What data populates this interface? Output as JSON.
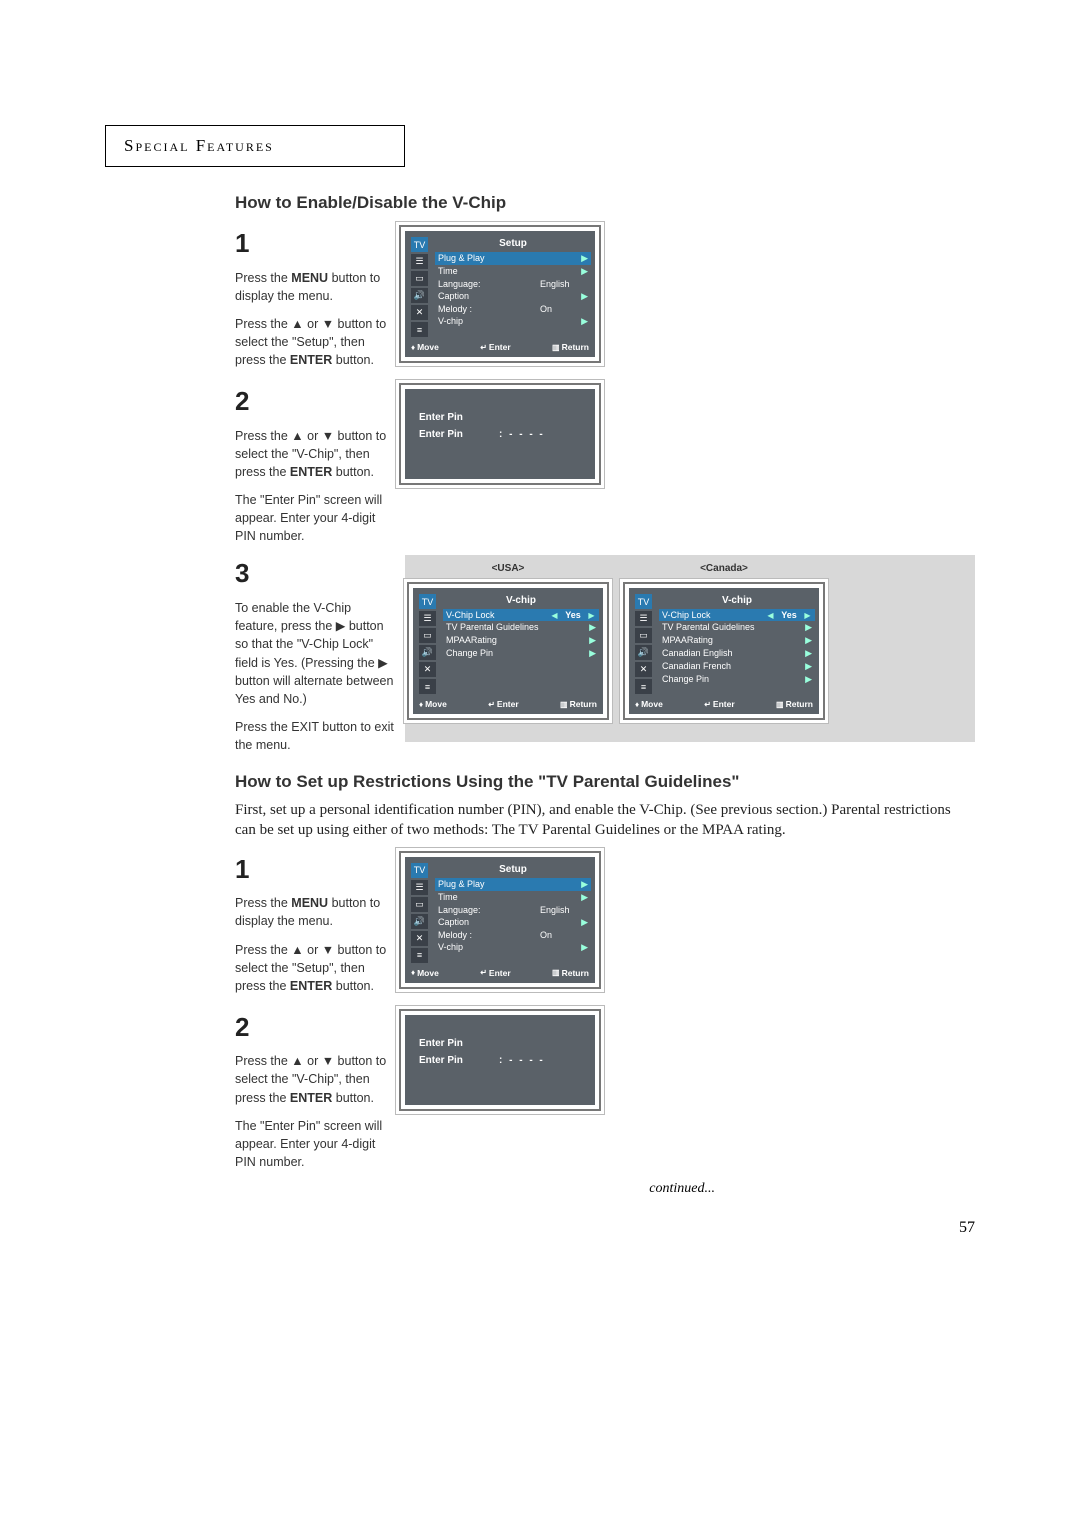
{
  "header": {
    "title": "Special Features"
  },
  "section1": {
    "title": "How to Enable/Disable the V-Chip",
    "step1": {
      "num": "1",
      "para1_a": "Press the ",
      "para1_b": "MENU",
      "para1_c": " button to display the menu.",
      "para2_a": "Press the ▲ or ▼ button to select the \"Setup\", then press the ",
      "para2_b": "ENTER",
      "para2_c": " button."
    },
    "step2": {
      "num": "2",
      "para1_a": "Press the ▲ or ▼ button to select the \"V-Chip\", then press the ",
      "para1_b": "ENTER",
      "para1_c": " button.",
      "para2": "The \"Enter Pin\" screen will appear. Enter your 4-digit PIN number."
    },
    "step3": {
      "num": "3",
      "para1": "To enable the V-Chip feature, press the ▶ button so that the \"V-Chip Lock\" field is Yes. (Pressing the ▶ button will alternate between Yes and No.)",
      "para2": "Press the EXIT button to exit the menu."
    }
  },
  "section2": {
    "title": "How to Set up Restrictions Using the \"TV Parental Guidelines\"",
    "lead": "First, set up a personal identification number (PIN), and enable the V-Chip. (See previous section.)  Parental restrictions can be set up using either of two methods: The TV Parental Guidelines or the MPAA rating.",
    "step1": {
      "num": "1",
      "para1_a": "Press the ",
      "para1_b": "MENU",
      "para1_c": " button to display the menu.",
      "para2_a": "Press the ▲ or ▼ button to select the \"Setup\", then press the ",
      "para2_b": "ENTER",
      "para2_c": " button."
    },
    "step2": {
      "num": "2",
      "para1_a": "Press the ▲ or ▼ button to select the \"V-Chip\", then press the ",
      "para1_b": "ENTER",
      "para1_c": " button.",
      "para2": "The \"Enter Pin\" screen will appear. Enter your 4-digit PIN number."
    }
  },
  "osd_setup": {
    "title": "Setup",
    "tv": "TV",
    "items": [
      {
        "label": "Plug & Play",
        "val": "",
        "sel": true
      },
      {
        "label": "Time",
        "val": ""
      },
      {
        "label": "Language:",
        "val": "English"
      },
      {
        "label": "Caption",
        "val": ""
      },
      {
        "label": "Melody   :",
        "val": "On"
      },
      {
        "label": "V-chip",
        "val": ""
      }
    ],
    "footer": {
      "move": "Move",
      "enter": "Enter",
      "return": "Return"
    }
  },
  "osd_pin": {
    "row1": "Enter Pin",
    "row2": "Enter Pin",
    "val": ": - - - -"
  },
  "region": {
    "usa": "<USA>",
    "canada": "<Canada>"
  },
  "osd_vchip_usa": {
    "title": "V-chip",
    "tv": "TV",
    "items": [
      {
        "label": "V-Chip Lock",
        "val": "Yes",
        "sel": true,
        "lr": true
      },
      {
        "label": "TV Parental Guidelines"
      },
      {
        "label": "MPAARating"
      },
      {
        "label": "Change Pin"
      }
    ],
    "footer": {
      "move": "Move",
      "enter": "Enter",
      "return": "Return"
    }
  },
  "osd_vchip_can": {
    "title": "V-chip",
    "tv": "TV",
    "items": [
      {
        "label": "V-Chip Lock",
        "val": "Yes",
        "sel": true,
        "lr": true
      },
      {
        "label": "TV Parental Guidelines"
      },
      {
        "label": "MPAARating"
      },
      {
        "label": "Canadian English"
      },
      {
        "label": "Canadian French"
      },
      {
        "label": "Change Pin"
      }
    ],
    "footer": {
      "move": "Move",
      "enter": "Enter",
      "return": "Return"
    }
  },
  "continued": "continued...",
  "page_num": "57"
}
